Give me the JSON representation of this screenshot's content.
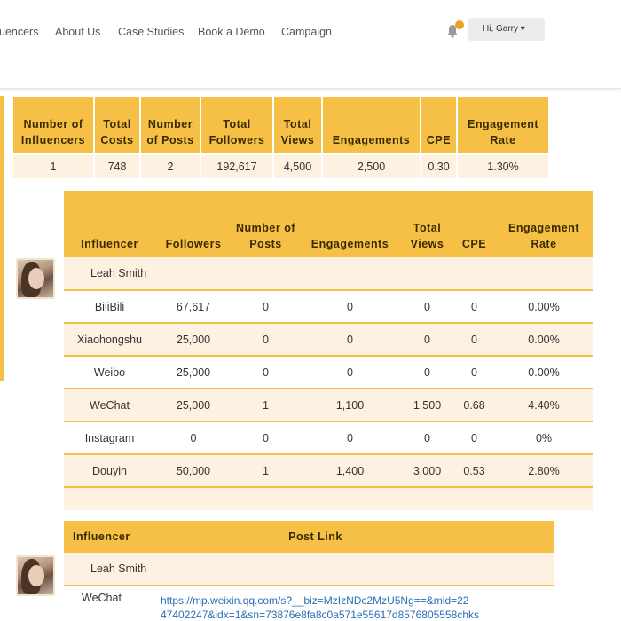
{
  "nav": {
    "links": [
      "uencers",
      "About Us",
      "Case Studies",
      "Book a Demo",
      "Campaign"
    ],
    "user_greeting": "Hi, Garry ▾",
    "notification_icon": "bell-icon",
    "notification_badge_color": "#f0a020"
  },
  "colors": {
    "accent": "#f5c045",
    "row_tint": "#fdf1e1",
    "link": "#2a6fb5"
  },
  "summary": {
    "headers": [
      "Number of Influencers",
      "Total Costs",
      "Number of Posts",
      "Total Followers",
      "Total Views",
      "Engagements",
      "CPE",
      "Engagement Rate"
    ],
    "row": [
      "1",
      "748",
      "2",
      "192,617",
      "4,500",
      "2,500",
      "0.30",
      "1.30%"
    ]
  },
  "breakdown": {
    "headers": [
      "Influencer",
      "Followers",
      "Number of Posts",
      "Engagements",
      "Total Views",
      "CPE",
      "Engagement Rate"
    ],
    "influencer_name": "Leah Smith",
    "rows": [
      [
        "BiliBili",
        "67,617",
        "0",
        "0",
        "0",
        "0",
        "0.00%"
      ],
      [
        "Xiaohongshu",
        "25,000",
        "0",
        "0",
        "0",
        "0",
        "0.00%"
      ],
      [
        "Weibo",
        "25,000",
        "0",
        "0",
        "0",
        "0",
        "0.00%"
      ],
      [
        "WeChat",
        "25,000",
        "1",
        "1,100",
        "1,500",
        "0.68",
        "4.40%"
      ],
      [
        "Instagram",
        "0",
        "0",
        "0",
        "0",
        "0",
        "0%"
      ],
      [
        "Douyin",
        "50,000",
        "1",
        "1,400",
        "3,000",
        "0.53",
        "2.80%"
      ]
    ]
  },
  "links": {
    "headers": [
      "Influencer",
      "Post Link"
    ],
    "influencer_name": "Leah Smith",
    "rows": [
      {
        "platform": "WeChat",
        "url_line1": "https://mp.weixin.qq.com/s?__biz=MzIzNDc2MzU5Ng==&mid=22",
        "url_line2": "47402247&idx=1&sn=73876e8fa8c0a571e55617d8576805558chks"
      }
    ]
  }
}
